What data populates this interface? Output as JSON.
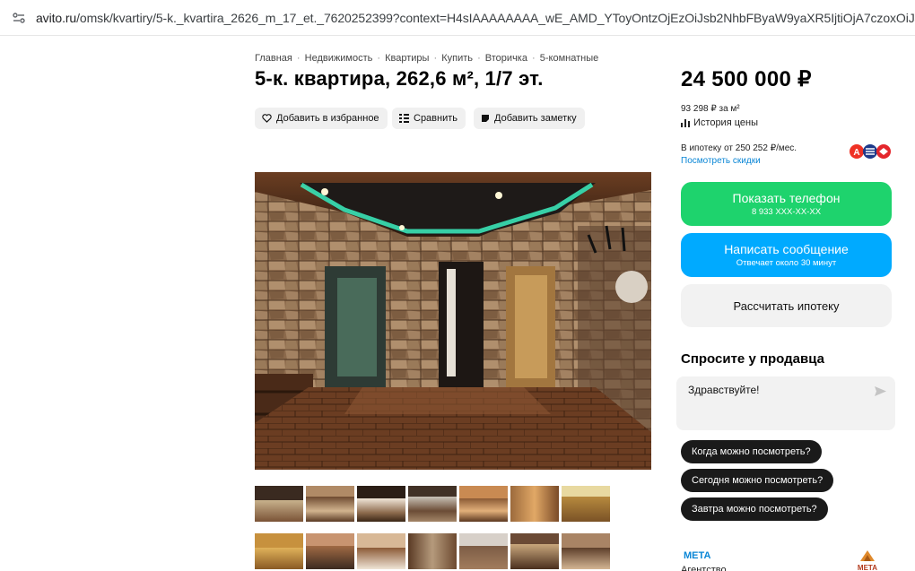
{
  "browser": {
    "url_host": "avito.ru",
    "url_path": "/omsk/kvartiry/5-k._kvartira_2626_m_17_et._7620252399?context=H4sIAAAAAAAA_wE_AMD_YToyOntzOjEzOiJsb2NhbFByaW9yaXR5IjtiOjA7czoxOiJ4IjtzOjE2OiJ5U2twbm"
  },
  "breadcrumb": [
    "Главная",
    "Недвижимость",
    "Квартиры",
    "Купить",
    "Вторичка",
    "5-комнатные"
  ],
  "listing": {
    "title": "5-к. квартира, 262,6 м², 1/7 эт.",
    "actions": {
      "favorite": "Добавить в избранное",
      "compare": "Сравнить",
      "note": "Добавить заметку"
    }
  },
  "pricing": {
    "price": "24 500 000 ₽",
    "per_m2": "93 298 ₽ за м²",
    "history": "История цены",
    "mortgage": "В ипотеку от 250 252 ₽/мес.",
    "discounts": "Посмотреть скидки"
  },
  "contact": {
    "phone_label": "Показать телефон",
    "phone_masked": "8 933 XXX-XX-XX",
    "message_label": "Написать сообщение",
    "message_sub": "Отвечает около 30 минут",
    "mortgage_calc": "Рассчитать ипотеку"
  },
  "ask_seller": {
    "title": "Спросите у продавца",
    "message": "Здравствуйте!",
    "quick_questions": [
      "Когда можно посмотреть?",
      "Сегодня можно посмотреть?",
      "Завтра можно посмотреть?"
    ]
  },
  "agency": {
    "name": "МЕТА",
    "type": "Агентство",
    "logo_text": "МЕТА"
  },
  "colors": {
    "phone_button": "#1ed36d",
    "message_button": "#00aaff",
    "link": "#0a86d6"
  }
}
